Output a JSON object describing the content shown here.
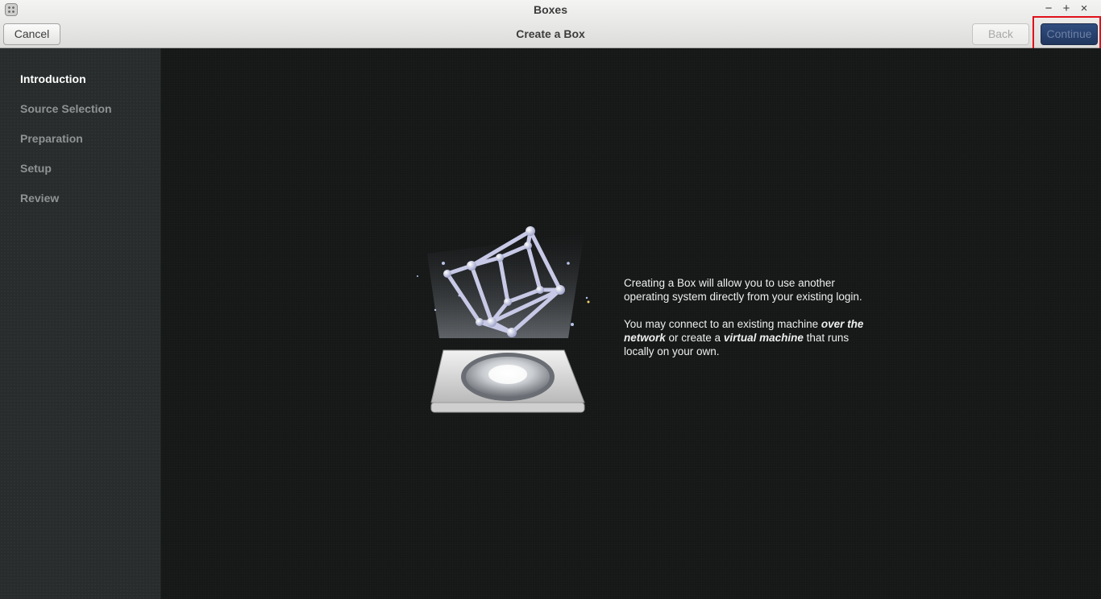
{
  "window": {
    "title": "Boxes",
    "subtitle": "Create a Box",
    "controls": [
      "−",
      "+",
      "×"
    ]
  },
  "toolbar": {
    "cancel_label": "Cancel",
    "back_label": "Back",
    "continue_label": "Continue"
  },
  "sidebar": {
    "steps": [
      {
        "label": "Introduction",
        "active": true
      },
      {
        "label": "Source Selection",
        "active": false
      },
      {
        "label": "Preparation",
        "active": false
      },
      {
        "label": "Setup",
        "active": false
      },
      {
        "label": "Review",
        "active": false
      }
    ]
  },
  "intro": {
    "paragraph1": "Creating a Box will allow you to use another operating system directly from your existing login.",
    "p2_part1": "You may connect to an existing machine ",
    "p2_em1": "over the network",
    "p2_part2": " or create a ",
    "p2_em2": "virtual machine",
    "p2_part3": " that runs locally on your own."
  },
  "icons": {
    "app": "boxes-app-icon",
    "illustration": "hypercube-projector-icon"
  },
  "colors": {
    "accent": "#2a4370",
    "highlight": "#e0101a",
    "sidebar_bg": "#282c2c",
    "main_bg": "#161818"
  }
}
